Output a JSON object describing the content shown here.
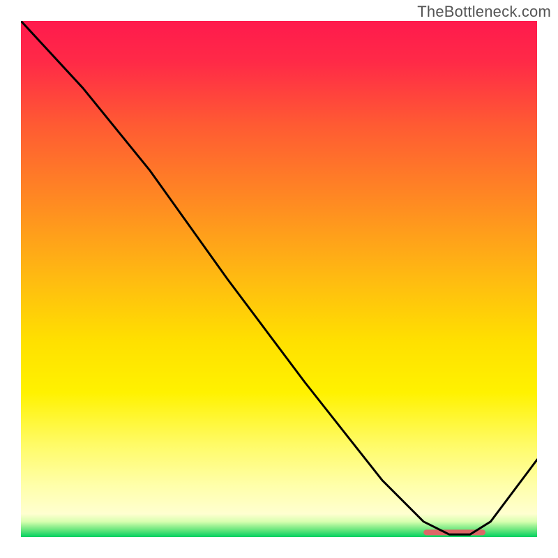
{
  "watermark": "TheBottleneck.com",
  "chart_data": {
    "type": "line",
    "title": "",
    "xlabel": "",
    "ylabel": "",
    "xlim": [
      0,
      100
    ],
    "ylim": [
      0,
      100
    ],
    "series": [
      {
        "name": "curve",
        "x": [
          0,
          12,
          25,
          40,
          55,
          70,
          78,
          83,
          87,
          91,
          100
        ],
        "y": [
          100,
          87,
          71,
          50,
          30,
          11,
          3,
          0.5,
          0.5,
          3,
          15
        ]
      }
    ],
    "highlight_segment": {
      "x_start": 78,
      "x_end": 90,
      "y": 0.9,
      "color": "#dd6666"
    },
    "gradient_stops": [
      {
        "offset": 0.0,
        "color": "#ff1a4d"
      },
      {
        "offset": 0.08,
        "color": "#ff2a47"
      },
      {
        "offset": 0.2,
        "color": "#ff5a33"
      },
      {
        "offset": 0.35,
        "color": "#ff8a22"
      },
      {
        "offset": 0.5,
        "color": "#ffbb11"
      },
      {
        "offset": 0.62,
        "color": "#ffe000"
      },
      {
        "offset": 0.72,
        "color": "#fff200"
      },
      {
        "offset": 0.82,
        "color": "#fffb66"
      },
      {
        "offset": 0.9,
        "color": "#ffffaa"
      },
      {
        "offset": 0.955,
        "color": "#ffffd0"
      },
      {
        "offset": 0.97,
        "color": "#d8ffb0"
      },
      {
        "offset": 0.985,
        "color": "#70e880"
      },
      {
        "offset": 1.0,
        "color": "#00d060"
      }
    ]
  }
}
